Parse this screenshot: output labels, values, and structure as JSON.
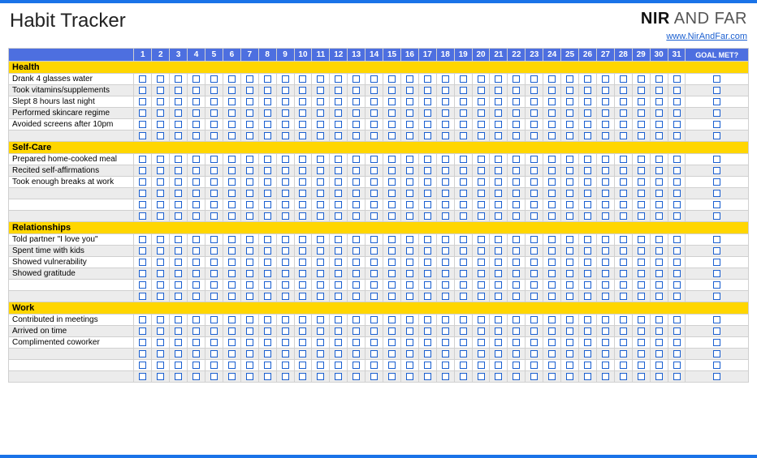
{
  "title": "Habit Tracker",
  "brand_nir": "NIR",
  "brand_and": " AND ",
  "brand_far": "FAR",
  "brand_url": "www.NirAndFar.com",
  "header": {
    "days": [
      "1",
      "2",
      "3",
      "4",
      "5",
      "6",
      "7",
      "8",
      "9",
      "10",
      "11",
      "12",
      "13",
      "14",
      "15",
      "16",
      "17",
      "18",
      "19",
      "20",
      "21",
      "22",
      "23",
      "24",
      "25",
      "26",
      "27",
      "28",
      "29",
      "30",
      "31"
    ],
    "goal_label": "GOAL MET?"
  },
  "sections": [
    {
      "name": "Health",
      "rows": [
        {
          "label": "Drank 4 glasses water"
        },
        {
          "label": "Took vitamins/supplements"
        },
        {
          "label": "Slept 8 hours last night"
        },
        {
          "label": "Performed skincare regime"
        },
        {
          "label": "Avoided screens after 10pm"
        },
        {
          "label": ""
        }
      ]
    },
    {
      "name": "Self-Care",
      "rows": [
        {
          "label": "Prepared home-cooked meal"
        },
        {
          "label": "Recited self-affirmations"
        },
        {
          "label": "Took enough breaks at work"
        },
        {
          "label": ""
        },
        {
          "label": ""
        },
        {
          "label": ""
        }
      ]
    },
    {
      "name": "Relationships",
      "rows": [
        {
          "label": "Told partner \"I love you\""
        },
        {
          "label": "Spent time with kids"
        },
        {
          "label": "Showed vulnerability"
        },
        {
          "label": "Showed gratitude"
        },
        {
          "label": ""
        },
        {
          "label": ""
        }
      ]
    },
    {
      "name": "Work",
      "rows": [
        {
          "label": "Contributed in meetings"
        },
        {
          "label": "Arrived on time"
        },
        {
          "label": "Complimented coworker"
        },
        {
          "label": ""
        },
        {
          "label": ""
        },
        {
          "label": ""
        }
      ]
    }
  ]
}
